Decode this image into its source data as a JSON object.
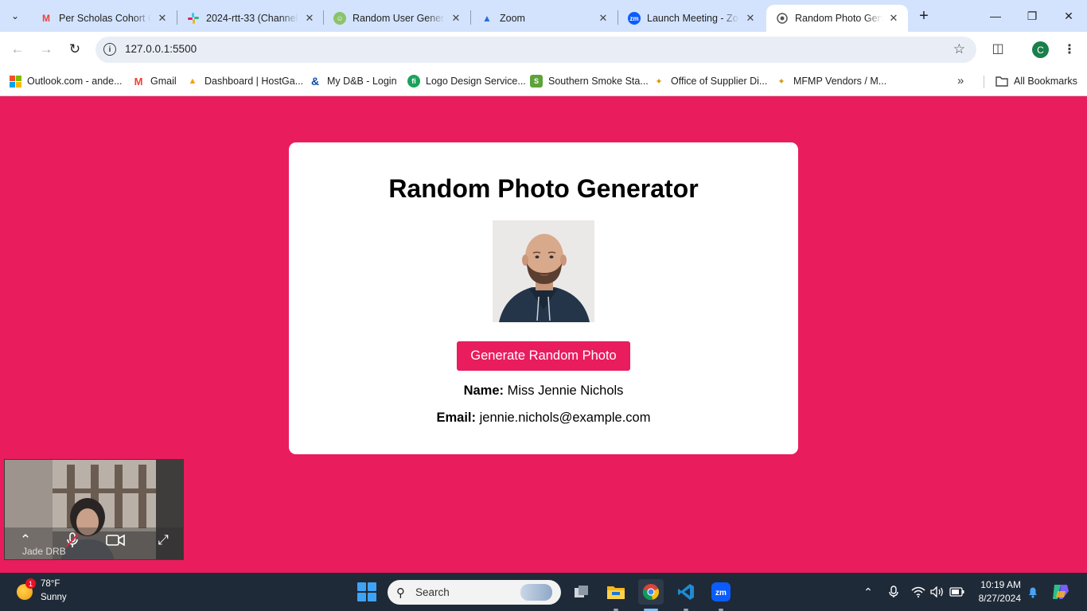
{
  "browser": {
    "tabs": [
      {
        "title": "Per Scholas Cohort Co",
        "favicon": "gmail-icon"
      },
      {
        "title": "2024-rtt-33 (Channel)",
        "favicon": "slack-icon"
      },
      {
        "title": "Random User Genera",
        "favicon": "random-user-icon"
      },
      {
        "title": "Zoom",
        "favicon": "per-scholas-icon"
      },
      {
        "title": "Launch Meeting - Zo",
        "favicon": "zoom-icon"
      },
      {
        "title": "Random Photo Gener",
        "favicon": "globe-icon",
        "active": true
      }
    ],
    "address": "127.0.0.1:5500",
    "profile_initial": "C",
    "bookmarks": [
      {
        "label": "Outlook.com - ande..."
      },
      {
        "label": "Gmail"
      },
      {
        "label": "Dashboard | HostGa..."
      },
      {
        "label": "My D&B - Login"
      },
      {
        "label": "Logo Design Service..."
      },
      {
        "label": "Southern Smoke Sta..."
      },
      {
        "label": "Office of Supplier Di..."
      },
      {
        "label": "MFMP Vendors / M..."
      }
    ],
    "all_bookmarks": "All Bookmarks"
  },
  "page": {
    "background": "#e91c5e",
    "title": "Random Photo Generator",
    "button_label": "Generate Random Photo",
    "name_label": "Name:",
    "name_value": "Miss Jennie Nichols",
    "email_label": "Email:",
    "email_value": "jennie.nichols@example.com"
  },
  "zoom_preview": {
    "participant": "Jade DRB"
  },
  "taskbar": {
    "weather_temp": "78°F",
    "weather_cond": "Sunny",
    "weather_badge": "1",
    "search_placeholder": "Search",
    "time": "10:19 AM",
    "date": "8/27/2024"
  }
}
